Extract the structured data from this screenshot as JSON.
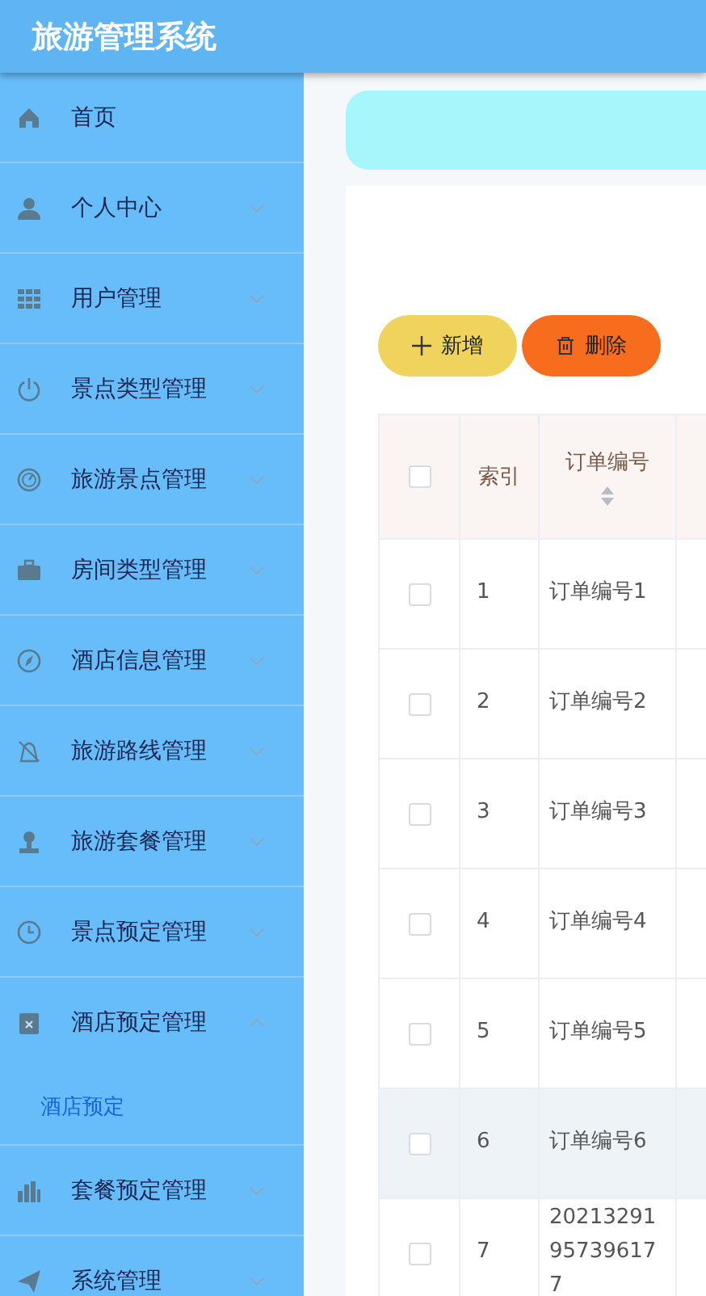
{
  "header": {
    "title": "旅游管理系统"
  },
  "sidebar": {
    "items": [
      {
        "label": "首页",
        "kind": "link",
        "expanded": false
      },
      {
        "label": "个人中心",
        "kind": "submenu",
        "expanded": false
      },
      {
        "label": "用户管理",
        "kind": "submenu",
        "expanded": false
      },
      {
        "label": "景点类型管理",
        "kind": "submenu",
        "expanded": false
      },
      {
        "label": "旅游景点管理",
        "kind": "submenu",
        "expanded": false
      },
      {
        "label": "房间类型管理",
        "kind": "submenu",
        "expanded": false
      },
      {
        "label": "酒店信息管理",
        "kind": "submenu",
        "expanded": false
      },
      {
        "label": "旅游路线管理",
        "kind": "submenu",
        "expanded": false
      },
      {
        "label": "旅游套餐管理",
        "kind": "submenu",
        "expanded": false
      },
      {
        "label": "景点预定管理",
        "kind": "submenu",
        "expanded": false
      },
      {
        "label": "酒店预定管理",
        "kind": "submenu",
        "expanded": true,
        "children": [
          {
            "label": "酒店预定",
            "selected": true
          }
        ]
      },
      {
        "label": "套餐预定管理",
        "kind": "submenu",
        "expanded": false
      },
      {
        "label": "系统管理",
        "kind": "submenu",
        "expanded": false
      }
    ]
  },
  "toolbar": {
    "buttons": [
      {
        "label": "新增",
        "kind": "add"
      },
      {
        "label": "删除",
        "kind": "delete"
      }
    ]
  },
  "table": {
    "select_all": {
      "checked": false
    },
    "columns": [
      "索引",
      "订单编号"
    ],
    "rows": [
      {
        "checked": false,
        "selected": false,
        "cells": [
          "1",
          "订单编号1"
        ]
      },
      {
        "checked": false,
        "selected": false,
        "cells": [
          "2",
          "订单编号2"
        ]
      },
      {
        "checked": false,
        "selected": false,
        "cells": [
          "3",
          "订单编号3"
        ]
      },
      {
        "checked": false,
        "selected": false,
        "cells": [
          "4",
          "订单编号4"
        ]
      },
      {
        "checked": false,
        "selected": false,
        "cells": [
          "5",
          "订单编号5"
        ]
      },
      {
        "checked": false,
        "selected": true,
        "cells": [
          "6",
          "订单编号6"
        ]
      },
      {
        "checked": false,
        "selected": false,
        "cells": [
          "7",
          "20213291957396177"
        ]
      }
    ]
  }
}
